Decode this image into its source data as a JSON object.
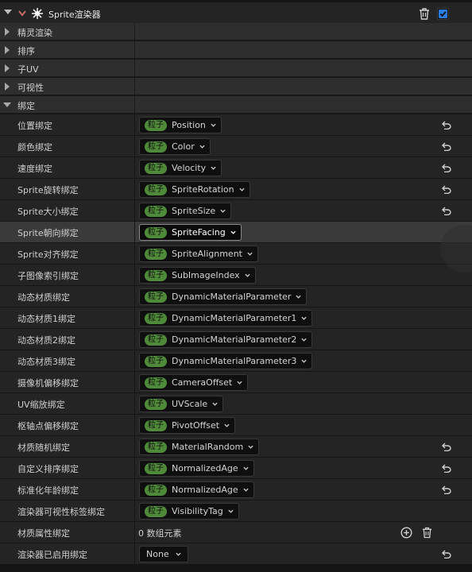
{
  "header": {
    "title": "Sprite渲染器",
    "enabled": true
  },
  "categories": [
    {
      "label": "精灵渲染",
      "expanded": false
    },
    {
      "label": "排序",
      "expanded": false
    },
    {
      "label": "子UV",
      "expanded": false
    },
    {
      "label": "可视性",
      "expanded": false
    },
    {
      "label": "绑定",
      "expanded": true
    }
  ],
  "badge_label": "粒子",
  "bindings": [
    {
      "label": "位置绑定",
      "value": "Position",
      "reset": true
    },
    {
      "label": "颜色绑定",
      "value": "Color",
      "reset": true
    },
    {
      "label": "速度绑定",
      "value": "Velocity",
      "reset": true
    },
    {
      "label": "Sprite旋转绑定",
      "value": "SpriteRotation",
      "reset": true
    },
    {
      "label": "Sprite大小绑定",
      "value": "SpriteSize",
      "reset": true
    },
    {
      "label": "Sprite朝向绑定",
      "value": "SpriteFacing",
      "reset": false,
      "highlighted": true
    },
    {
      "label": "Sprite对齐绑定",
      "value": "SpriteAlignment",
      "reset": false
    },
    {
      "label": "子图像索引绑定",
      "value": "SubImageIndex",
      "reset": false
    },
    {
      "label": "动态材质绑定",
      "value": "DynamicMaterialParameter",
      "reset": false
    },
    {
      "label": "动态材质1绑定",
      "value": "DynamicMaterialParameter1",
      "reset": false
    },
    {
      "label": "动态材质2绑定",
      "value": "DynamicMaterialParameter2",
      "reset": false
    },
    {
      "label": "动态材质3绑定",
      "value": "DynamicMaterialParameter3",
      "reset": false
    },
    {
      "label": "摄像机偏移绑定",
      "value": "CameraOffset",
      "reset": false
    },
    {
      "label": "UV缩放绑定",
      "value": "UVScale",
      "reset": false
    },
    {
      "label": "枢轴点偏移绑定",
      "value": "PivotOffset",
      "reset": false
    },
    {
      "label": "材质随机绑定",
      "value": "MaterialRandom",
      "reset": true
    },
    {
      "label": "自定义排序绑定",
      "value": "NormalizedAge",
      "reset": true
    },
    {
      "label": "标准化年龄绑定",
      "value": "NormalizedAge",
      "reset": true
    },
    {
      "label": "渲染器可视性标签绑定",
      "value": "VisibilityTag",
      "reset": false
    }
  ],
  "material_attributes": {
    "label": "材质属性绑定",
    "value": "0 数组元素"
  },
  "renderer_enabled": {
    "label": "渲染器已启用绑定",
    "value": "None"
  },
  "colors": {
    "badge": "#4f8a3a",
    "checkbox_accent": "#2b7be0",
    "row_bg": "#242424",
    "highlight_row": "#3a3a3a"
  }
}
